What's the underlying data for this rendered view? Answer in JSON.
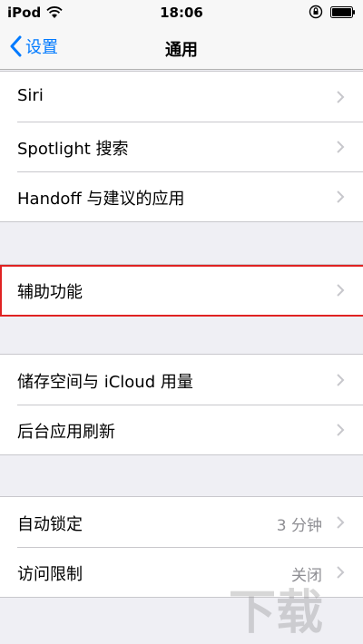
{
  "status_bar": {
    "carrier": "iPod",
    "time": "18:06",
    "icons": [
      "wifi-icon",
      "orientation-lock-icon",
      "battery-icon"
    ]
  },
  "nav": {
    "back_label": "设置",
    "title": "通用",
    "accent": "#007aff"
  },
  "groups": [
    {
      "rows": [
        {
          "label": "Siri"
        },
        {
          "label": "Spotlight 搜索"
        },
        {
          "label": "Handoff 与建议的应用"
        }
      ]
    },
    {
      "rows": [
        {
          "label": "辅助功能"
        }
      ]
    },
    {
      "rows": [
        {
          "label": "储存空间与 iCloud 用量"
        },
        {
          "label": "后台应用刷新"
        }
      ]
    },
    {
      "rows": [
        {
          "label": "自动锁定",
          "value": "3 分钟"
        },
        {
          "label": "访问限制",
          "value": "关闭"
        }
      ]
    }
  ],
  "highlight_color": "#e02222",
  "watermark": "下载吧"
}
